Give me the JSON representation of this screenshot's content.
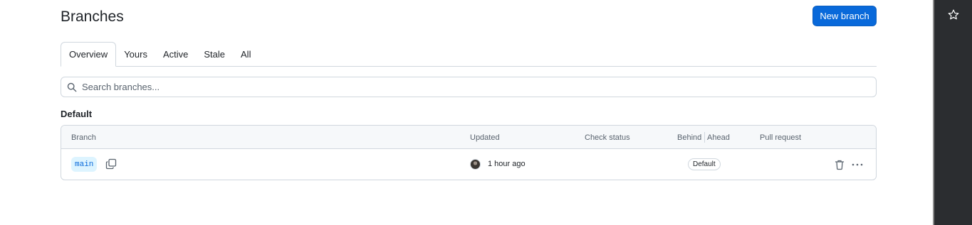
{
  "header": {
    "title": "Branches",
    "new_branch_label": "New branch"
  },
  "tabs": [
    {
      "label": "Overview",
      "selected": true
    },
    {
      "label": "Yours",
      "selected": false
    },
    {
      "label": "Active",
      "selected": false
    },
    {
      "label": "Stale",
      "selected": false
    },
    {
      "label": "All",
      "selected": false
    }
  ],
  "search": {
    "placeholder": "Search branches...",
    "value": "",
    "icon": "search-icon"
  },
  "section": {
    "title": "Default"
  },
  "table": {
    "columns": {
      "branch": "Branch",
      "updated": "Updated",
      "check_status": "Check status",
      "behind": "Behind",
      "ahead": "Ahead",
      "pull_request": "Pull request"
    },
    "rows": [
      {
        "branch": "main",
        "updated": "1 hour ago",
        "badge": "Default",
        "icons": [
          "copy-icon",
          "trash-icon",
          "kebab-icon"
        ]
      }
    ]
  },
  "side_panel": {
    "icon": "star-icon"
  },
  "colors": {
    "accent": "#0969da",
    "branch_bg": "#ddf4ff",
    "border": "#d0d7de",
    "header_bg": "#f6f8fa",
    "side_panel_bg": "#2b2d30"
  }
}
